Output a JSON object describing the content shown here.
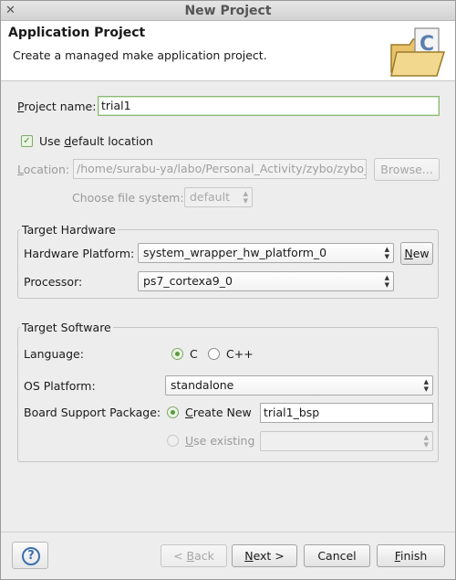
{
  "window": {
    "title": "New Project",
    "close_glyph": "✕"
  },
  "header": {
    "title": "Application Project",
    "description": "Create a managed make application project.",
    "icon": "new-c-project-folder-icon"
  },
  "project_name": {
    "label_prefix": "",
    "label_mnemonic": "P",
    "label_rest": "roject name:",
    "value": "trial1"
  },
  "default_location": {
    "checked": true,
    "label_prefix": "Use ",
    "label_mnemonic": "d",
    "label_rest": "efault location"
  },
  "location": {
    "label_prefix": "",
    "label_mnemonic": "L",
    "label_rest": "ocation:",
    "value": "/home/surabu-ya/labo/Personal_Activity/zybo/zybo_ba",
    "browse_label": "Browse..."
  },
  "file_system": {
    "label": "Choose file system:",
    "value": "default"
  },
  "target_hardware": {
    "group_label": "Target Hardware",
    "platform_label": "Hardware Platform:",
    "platform_value": "system_wrapper_hw_platform_0",
    "new_prefix": "",
    "new_mnemonic": "N",
    "new_rest": "ew",
    "processor_label": "Processor:",
    "processor_value": "ps7_cortexa9_0"
  },
  "target_software": {
    "group_label": "Target Software",
    "language_label": "Language:",
    "lang_c": "C",
    "lang_cpp": "C++",
    "lang_selected": "C",
    "os_label": "OS Platform:",
    "os_value": "standalone",
    "bsp_label": "Board Support Package:",
    "create_new_prefix": "",
    "create_new_mnemonic": "C",
    "create_new_rest": "reate New",
    "bsp_name": "trial1_bsp",
    "use_existing_prefix": "",
    "use_existing_mnemonic": "U",
    "use_existing_rest": "se existing"
  },
  "footer": {
    "help_icon": "help-icon",
    "back_prefix": "< ",
    "back_mnemonic": "B",
    "back_rest": "ack",
    "next_prefix": "",
    "next_mnemonic": "N",
    "next_rest": "ext >",
    "cancel_label": "Cancel",
    "finish_prefix": "",
    "finish_mnemonic": "F",
    "finish_rest": "inish"
  },
  "colors": {
    "accent_green": "#5c9a3e",
    "window_bg": "#ededed",
    "help_blue": "#3a6fb0"
  }
}
